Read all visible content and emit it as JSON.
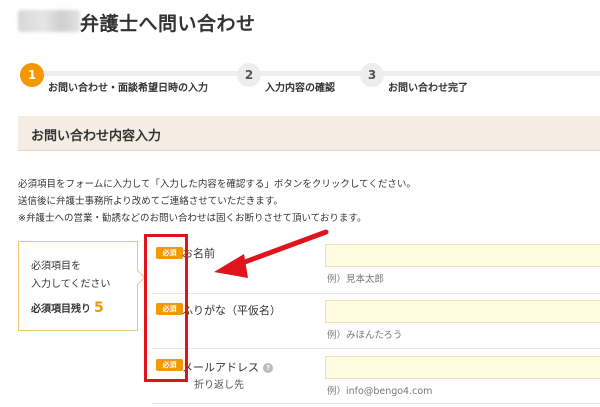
{
  "header": {
    "title": "弁護士へ問い合わせ"
  },
  "steps": [
    {
      "number": "1",
      "label": "お問い合わせ・面談希望日時の入力",
      "active": true
    },
    {
      "number": "2",
      "label": "入力内容の確認",
      "active": false
    },
    {
      "number": "3",
      "label": "お問い合わせ完了",
      "active": false
    }
  ],
  "section": {
    "title": "お問い合わせ内容入力"
  },
  "intro": [
    "必須項目をフォームに入力して「入力した内容を確認する」ボタンをクリックしてください。",
    "送信後に弁護士事務所より改めてご連絡させていただきます。",
    "※弁護士への営業・勧誘などのお問い合わせは固くお断りさせて頂いております。"
  ],
  "remaining": {
    "line1": "必須項目を",
    "line2": "入力してください",
    "label": "必須項目残り",
    "count": "5"
  },
  "fields": [
    {
      "badge": "必須",
      "label": "お名前",
      "example": "例）見本太郎"
    },
    {
      "badge": "必須",
      "label": "ふりがな（平仮名）",
      "example": "例）みほんたろう"
    },
    {
      "badge": "必須",
      "label": "メールアドレス",
      "help": "?",
      "sublabel": "折り返し先",
      "example": "例）info@bengo4.com"
    }
  ],
  "colors": {
    "accent": "#f39800",
    "annotation": "#e0141b",
    "section_bg": "#f5ece4",
    "input_bg": "#fffbe0"
  }
}
